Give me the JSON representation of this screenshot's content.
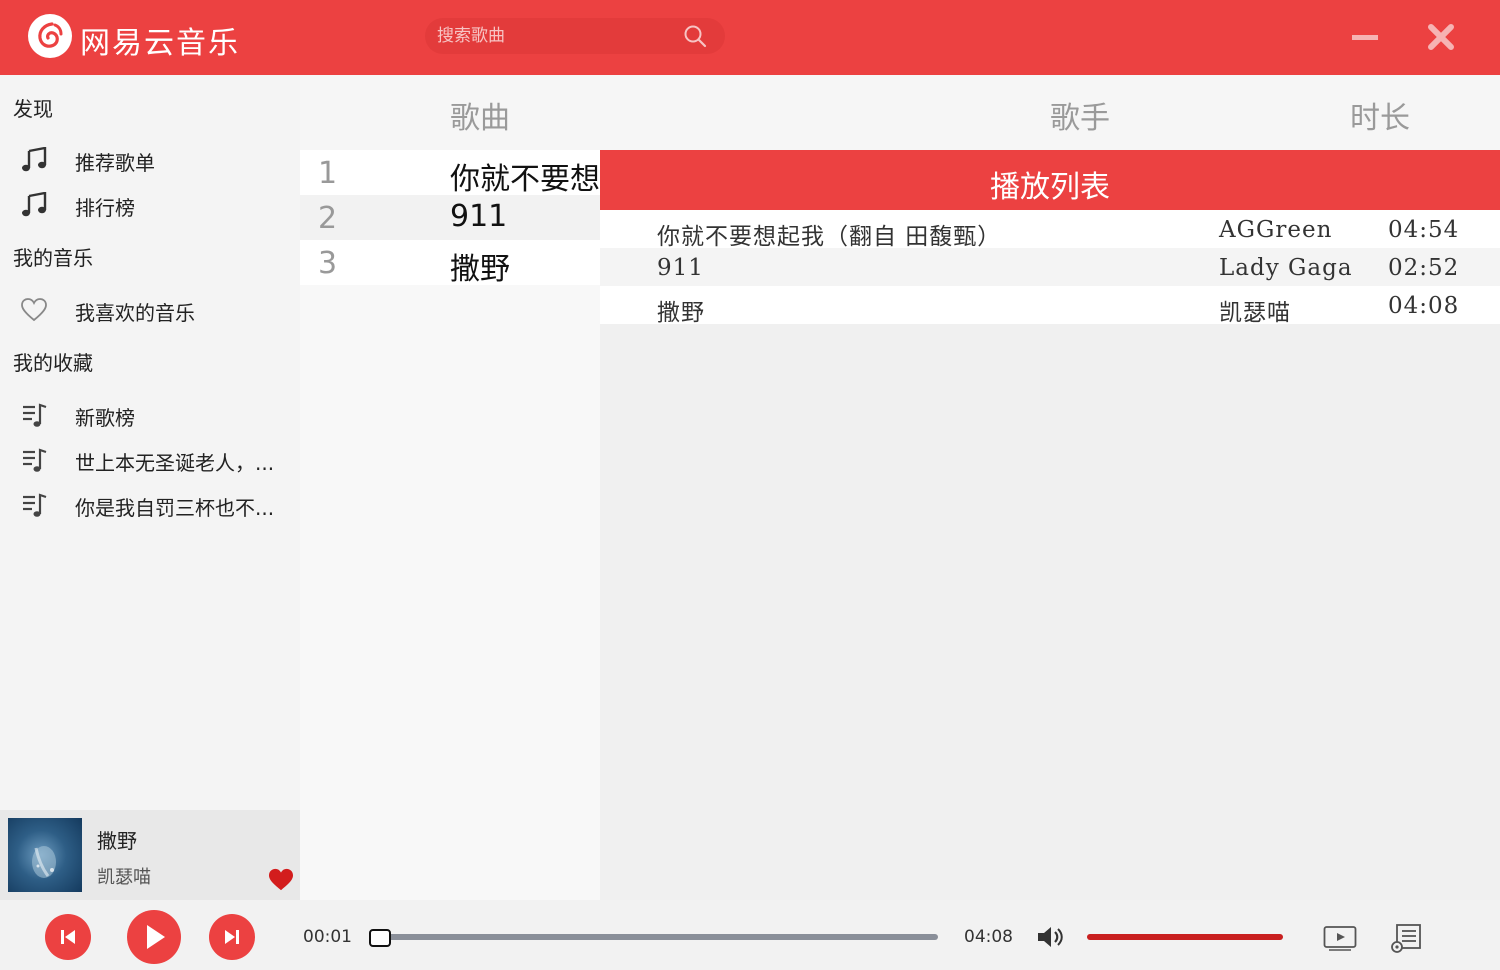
{
  "app": {
    "title": "网易云音乐"
  },
  "search": {
    "placeholder": "搜索歌曲"
  },
  "sidebar": {
    "discover": {
      "heading": "发现",
      "items": [
        {
          "label": "推荐歌单",
          "icon": "music-note-icon"
        },
        {
          "label": "排行榜",
          "icon": "music-note-icon"
        }
      ]
    },
    "my_music": {
      "heading": "我的音乐",
      "items": [
        {
          "label": "我喜欢的音乐",
          "icon": "heart-icon"
        }
      ]
    },
    "favorites": {
      "heading": "我的收藏",
      "items": [
        {
          "label": "新歌榜",
          "icon": "playlist-icon"
        },
        {
          "label": "世上本无圣诞老人，...",
          "icon": "playlist-icon"
        },
        {
          "label": "你是我自罚三杯也不...",
          "icon": "playlist-icon"
        }
      ]
    }
  },
  "now_playing": {
    "title": "撒野",
    "artist": "凯瑟喵",
    "liked": true
  },
  "song_list": {
    "columns": {
      "song": "歌曲",
      "artist": "歌手",
      "duration": "时长"
    },
    "rows": [
      {
        "num": "1",
        "name": "你就不要想"
      },
      {
        "num": "2",
        "name": "911"
      },
      {
        "num": "3",
        "name": "撒野"
      }
    ]
  },
  "playlist": {
    "title": "播放列表",
    "rows": [
      {
        "name": "你就不要想起我（翻自 田馥甄）",
        "artist": "AGGreen",
        "duration": "04:54"
      },
      {
        "name": "911",
        "artist": "Lady Gaga",
        "duration": "02:52"
      },
      {
        "name": "撒野",
        "artist": "凯瑟喵",
        "duration": "04:08"
      }
    ]
  },
  "player": {
    "current_time": "00:01",
    "total_time": "04:08",
    "progress_fraction": 0.004,
    "volume_fraction": 1.0
  },
  "colors": {
    "accent": "#ec4141",
    "volume": "#c91f1f"
  }
}
